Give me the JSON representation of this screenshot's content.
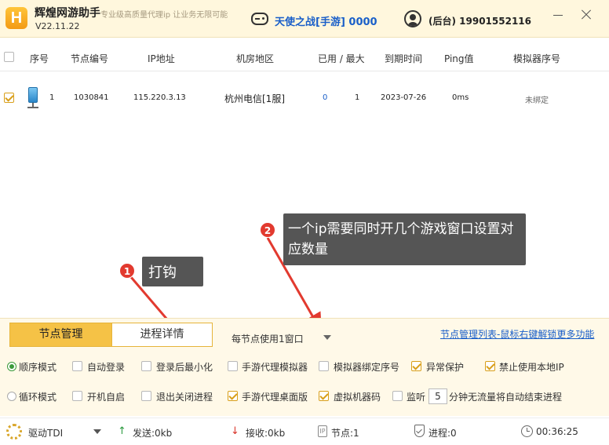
{
  "titlebar": {
    "app_name": "辉煌网游助手",
    "slogan": "专业级高质量代理ip 让业务无限可能",
    "version": "V22.11.22",
    "game_name": "天使之战[手游] 0000",
    "user_label": "(后台) 19901552116"
  },
  "table": {
    "headers": [
      "序号",
      "节点编号",
      "IP地址",
      "机房地区",
      "已用 / 最大",
      "到期时间",
      "Ping值",
      "模拟器序号"
    ],
    "rows": [
      {
        "index": "1",
        "node_id": "1030841",
        "ip": "115.220.3.13",
        "region": "杭州电信[1服]",
        "used": "0",
        "max": "1",
        "expiry": "2023-07-26",
        "ping": "0ms",
        "emulator": "未绑定"
      }
    ]
  },
  "annotations": {
    "note1": "打钩",
    "note2": "一个ip需要同时开几个游戏窗口设置对应数量",
    "badge1": "1",
    "badge2": "2"
  },
  "panel": {
    "tab_active": "节点管理",
    "tab_inactive": "进程详情",
    "dropdown_value": "每节点使用1窗口",
    "link": "节点管理列表-鼠标右键解锁更多功能",
    "mode1": "顺序模式",
    "mode2": "循环模式",
    "options": {
      "auto_login": "自动登录",
      "minimize_after_login": "登录后最小化",
      "mobile_proxy_emulator": "手游代理模拟器",
      "emulator_bind_index": "模拟器绑定序号",
      "abnormal_protect": "异常保护",
      "disable_local_ip": "禁止使用本地IP",
      "autostart": "开机自启",
      "exit_close_process": "退出关闭进程",
      "mobile_proxy_desktop": "手游代理桌面版",
      "virtual_machine_code": "虚拟机器码",
      "monitor": "监听",
      "monitor_value": "5",
      "monitor_suffix": "分钟无流量将自动结束进程"
    }
  },
  "status": {
    "driver": "驱动TDI",
    "sent": "发送:0kb",
    "received": "接收:0kb",
    "nodes": "节点:1",
    "processes": "进程:0",
    "time": "00:36:25"
  }
}
